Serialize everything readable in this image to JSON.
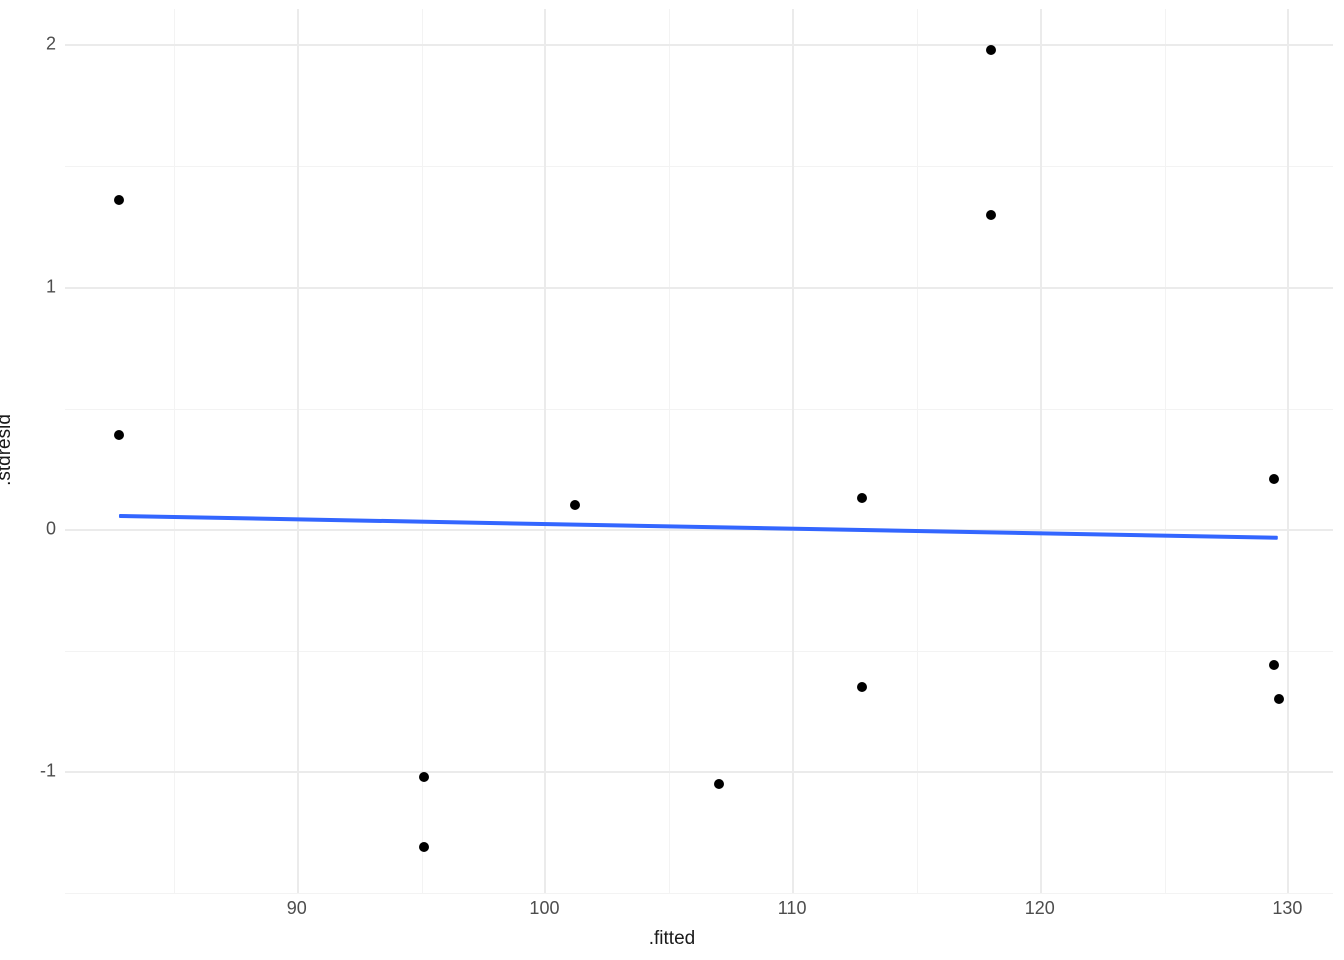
{
  "chart_data": {
    "type": "scatter",
    "xlabel": ".fitted",
    "ylabel": ".stdresid",
    "xlim": [
      80.6,
      131.8
    ],
    "ylim": [
      -1.5,
      2.15
    ],
    "x_ticks": [
      90,
      100,
      110,
      120,
      130
    ],
    "y_ticks": [
      -1,
      0,
      1,
      2
    ],
    "x_minor": [
      85,
      95,
      105,
      115,
      125
    ],
    "y_minor": [
      -1.5,
      -0.5,
      0.5,
      1.5
    ],
    "points": [
      {
        "x": 82.8,
        "y": 1.36
      },
      {
        "x": 82.8,
        "y": 0.39
      },
      {
        "x": 95.1,
        "y": -1.02
      },
      {
        "x": 95.1,
        "y": -1.31
      },
      {
        "x": 101.2,
        "y": 0.1
      },
      {
        "x": 107.0,
        "y": -1.05
      },
      {
        "x": 112.8,
        "y": 0.13
      },
      {
        "x": 112.8,
        "y": -0.65
      },
      {
        "x": 118.0,
        "y": 1.98
      },
      {
        "x": 118.0,
        "y": 1.3
      },
      {
        "x": 129.4,
        "y": 0.21
      },
      {
        "x": 129.4,
        "y": -0.56
      },
      {
        "x": 129.6,
        "y": -0.7
      }
    ],
    "trend": {
      "x1": 82.8,
      "y1": 0.055,
      "x2": 129.6,
      "y2": -0.035,
      "color": "#3366ff"
    },
    "panel_background": "#ffffff",
    "grid_color": "#ebebeb"
  }
}
